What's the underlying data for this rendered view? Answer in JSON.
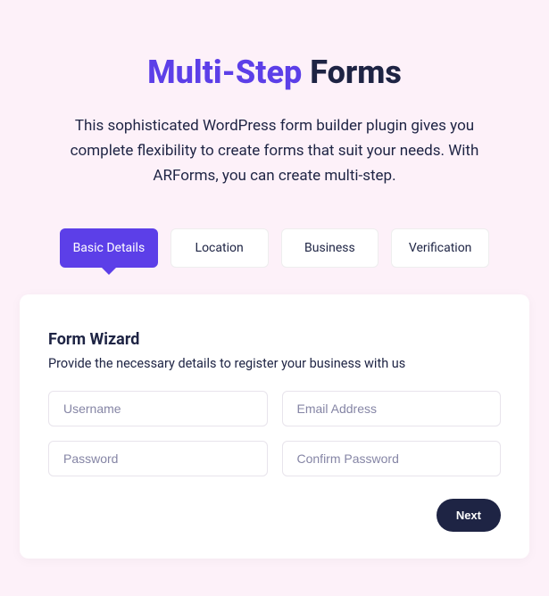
{
  "header": {
    "title_accent": "Multi-Step",
    "title_rest": " Forms",
    "subtitle": "This sophisticated WordPress form builder plugin gives you complete flexibility to create forms that suit your needs. With ARForms, you can create multi-step."
  },
  "tabs": [
    {
      "label": "Basic Details",
      "active": true
    },
    {
      "label": "Location",
      "active": false
    },
    {
      "label": "Business",
      "active": false
    },
    {
      "label": "Verification",
      "active": false
    }
  ],
  "form": {
    "title": "Form Wizard",
    "subtitle": "Provide the necessary details to register your business with us",
    "fields": {
      "username_placeholder": "Username",
      "email_placeholder": "Email Address",
      "password_placeholder": "Password",
      "confirm_password_placeholder": "Confirm Password"
    },
    "next_label": "Next"
  }
}
